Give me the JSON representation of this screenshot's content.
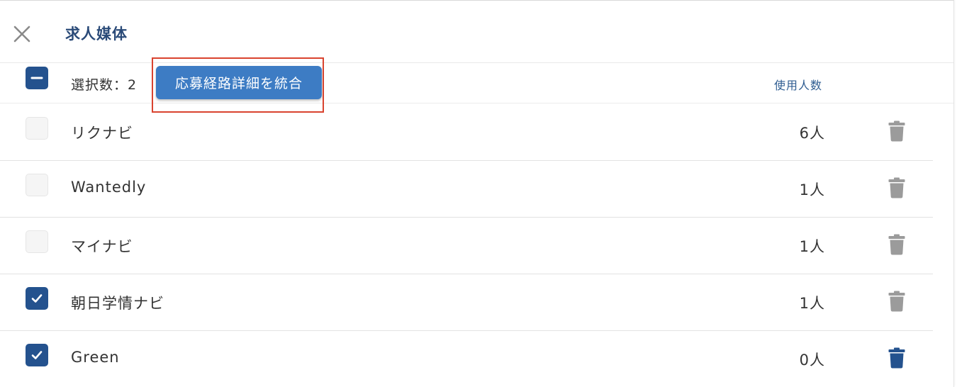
{
  "header": {
    "title": "求人媒体",
    "close_icon": "close-icon"
  },
  "bulk": {
    "selection_label": "選択数：2",
    "merge_button_label": "応募経路詳細を統合",
    "column_header": "使用人数",
    "select_all_state": "indeterminate"
  },
  "rows": [
    {
      "label": "リクナビ",
      "count": "6人",
      "checked": false,
      "delete_enabled": false
    },
    {
      "label": "Wantedly",
      "count": "1人",
      "checked": false,
      "delete_enabled": false
    },
    {
      "label": "マイナビ",
      "count": "1人",
      "checked": false,
      "delete_enabled": false
    },
    {
      "label": "朝日学情ナビ",
      "count": "1人",
      "checked": true,
      "delete_enabled": false
    },
    {
      "label": "Green",
      "count": "0人",
      "checked": true,
      "delete_enabled": true
    }
  ],
  "colors": {
    "primary": "#24528e",
    "button": "#3d7cc4",
    "highlight": "#d9432f",
    "trash_disabled": "#9b9b9b",
    "trash_enabled": "#24528e"
  }
}
